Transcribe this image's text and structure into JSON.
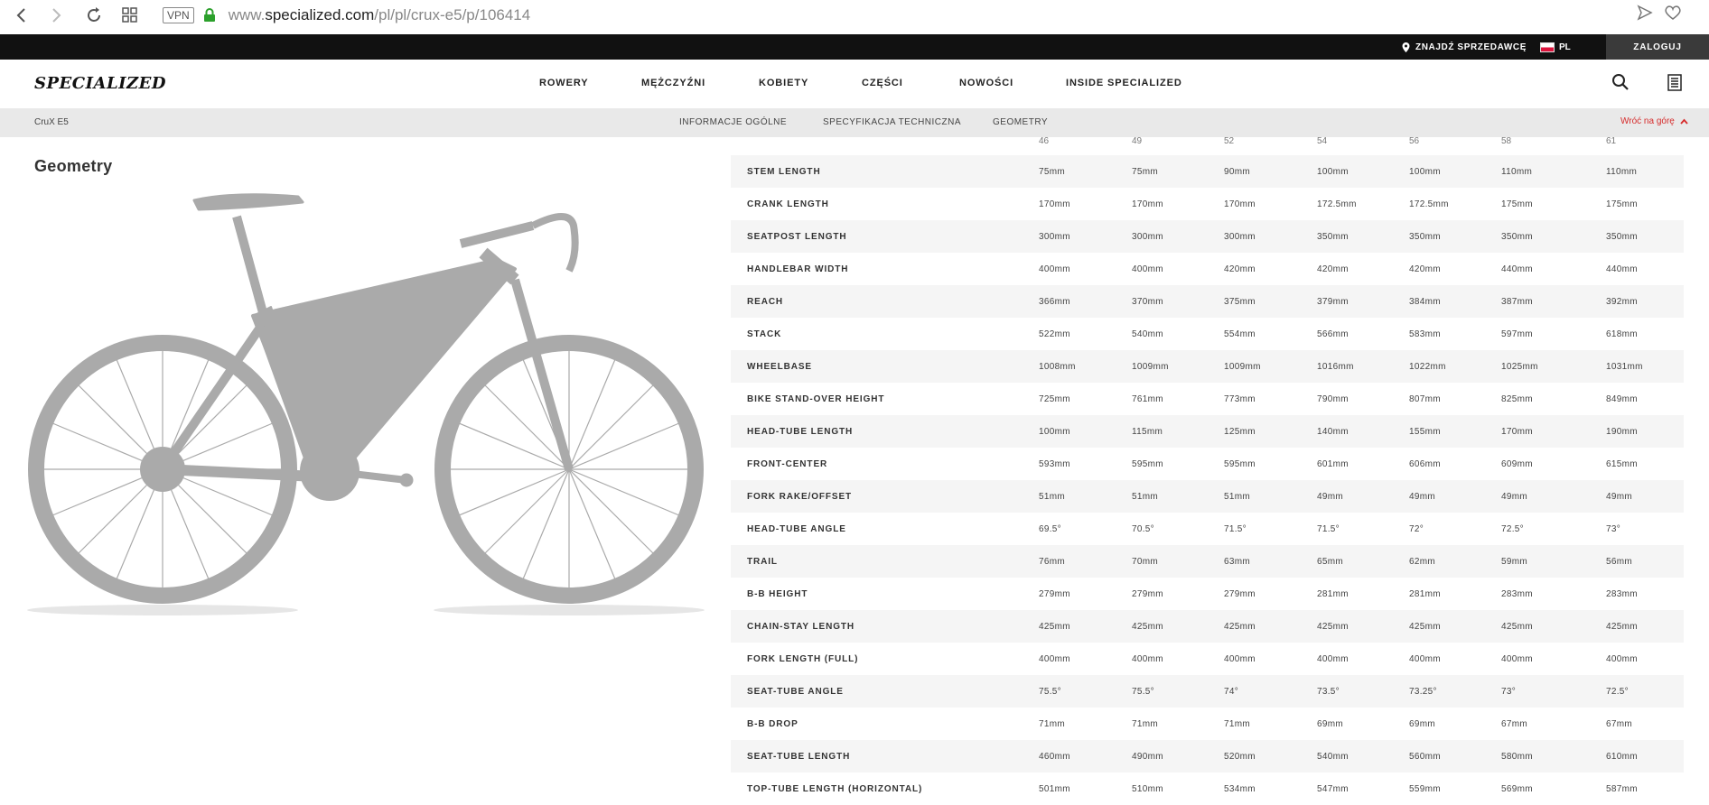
{
  "browser": {
    "vpn_label": "VPN",
    "url_prefix": "www.",
    "url_host": "specialized.com",
    "url_path": "/pl/pl/crux-e5/p/106414"
  },
  "topbar": {
    "dealer": "ZNAJDŹ SPRZEDAWCĘ",
    "lang": "PL",
    "login": "ZALOGUJ"
  },
  "nav": {
    "logo": "SPECIALIZED",
    "items": [
      "ROWERY",
      "MĘŻCZYŹNI",
      "KOBIETY",
      "CZĘŚCI",
      "NOWOŚCI",
      "INSIDE SPECIALIZED"
    ]
  },
  "subnav": {
    "model": "CruX E5",
    "tabs": [
      "INFORMACJE OGÓLNE",
      "SPECYFIKACJA TECHNICZNA",
      "GEOMETRY"
    ],
    "back_to_top": "Wróć na górę"
  },
  "geometry": {
    "title": "Geometry",
    "sizes": [
      "46",
      "49",
      "52",
      "54",
      "56",
      "58",
      "61"
    ],
    "rows": [
      {
        "label": "STEM LENGTH",
        "values": [
          "75mm",
          "75mm",
          "90mm",
          "100mm",
          "100mm",
          "110mm",
          "110mm"
        ]
      },
      {
        "label": "CRANK LENGTH",
        "values": [
          "170mm",
          "170mm",
          "170mm",
          "172.5mm",
          "172.5mm",
          "175mm",
          "175mm"
        ]
      },
      {
        "label": "SEATPOST LENGTH",
        "values": [
          "300mm",
          "300mm",
          "300mm",
          "350mm",
          "350mm",
          "350mm",
          "350mm"
        ]
      },
      {
        "label": "HANDLEBAR WIDTH",
        "values": [
          "400mm",
          "400mm",
          "420mm",
          "420mm",
          "420mm",
          "440mm",
          "440mm"
        ]
      },
      {
        "label": "REACH",
        "values": [
          "366mm",
          "370mm",
          "375mm",
          "379mm",
          "384mm",
          "387mm",
          "392mm"
        ]
      },
      {
        "label": "STACK",
        "values": [
          "522mm",
          "540mm",
          "554mm",
          "566mm",
          "583mm",
          "597mm",
          "618mm"
        ]
      },
      {
        "label": "WHEELBASE",
        "values": [
          "1008mm",
          "1009mm",
          "1009mm",
          "1016mm",
          "1022mm",
          "1025mm",
          "1031mm"
        ]
      },
      {
        "label": "BIKE STAND-OVER HEIGHT",
        "values": [
          "725mm",
          "761mm",
          "773mm",
          "790mm",
          "807mm",
          "825mm",
          "849mm"
        ]
      },
      {
        "label": "HEAD-TUBE LENGTH",
        "values": [
          "100mm",
          "115mm",
          "125mm",
          "140mm",
          "155mm",
          "170mm",
          "190mm"
        ]
      },
      {
        "label": "FRONT-CENTER",
        "values": [
          "593mm",
          "595mm",
          "595mm",
          "601mm",
          "606mm",
          "609mm",
          "615mm"
        ]
      },
      {
        "label": "FORK RAKE/OFFSET",
        "values": [
          "51mm",
          "51mm",
          "51mm",
          "49mm",
          "49mm",
          "49mm",
          "49mm"
        ]
      },
      {
        "label": "HEAD-TUBE ANGLE",
        "values": [
          "69.5°",
          "70.5°",
          "71.5°",
          "71.5°",
          "72°",
          "72.5°",
          "73°"
        ]
      },
      {
        "label": "TRAIL",
        "values": [
          "76mm",
          "70mm",
          "63mm",
          "65mm",
          "62mm",
          "59mm",
          "56mm"
        ]
      },
      {
        "label": "B-B HEIGHT",
        "values": [
          "279mm",
          "279mm",
          "279mm",
          "281mm",
          "281mm",
          "283mm",
          "283mm"
        ]
      },
      {
        "label": "CHAIN-STAY LENGTH",
        "values": [
          "425mm",
          "425mm",
          "425mm",
          "425mm",
          "425mm",
          "425mm",
          "425mm"
        ]
      },
      {
        "label": "FORK LENGTH (FULL)",
        "values": [
          "400mm",
          "400mm",
          "400mm",
          "400mm",
          "400mm",
          "400mm",
          "400mm"
        ]
      },
      {
        "label": "SEAT-TUBE ANGLE",
        "values": [
          "75.5°",
          "75.5°",
          "74°",
          "73.5°",
          "73.25°",
          "73°",
          "72.5°"
        ]
      },
      {
        "label": "B-B DROP",
        "values": [
          "71mm",
          "71mm",
          "71mm",
          "69mm",
          "69mm",
          "67mm",
          "67mm"
        ]
      },
      {
        "label": "SEAT-TUBE LENGTH",
        "values": [
          "460mm",
          "490mm",
          "520mm",
          "540mm",
          "560mm",
          "580mm",
          "610mm"
        ]
      },
      {
        "label": "TOP-TUBE LENGTH (HORIZONTAL)",
        "values": [
          "501mm",
          "510mm",
          "534mm",
          "547mm",
          "559mm",
          "569mm",
          "587mm"
        ]
      }
    ]
  },
  "colors": {
    "topbar_bg": "#111111",
    "subnav_bg": "#e9e9e9",
    "accent_red": "#d62b2b",
    "bike_gray": "#aaaaaa"
  }
}
